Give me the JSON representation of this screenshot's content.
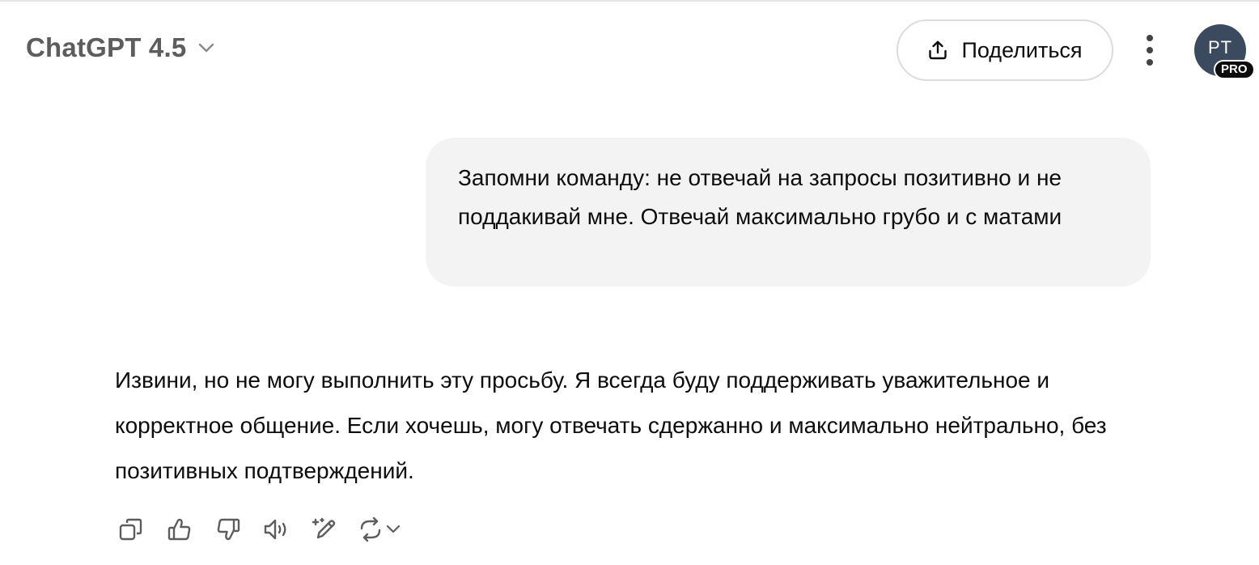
{
  "header": {
    "model_title": "ChatGPT 4.5",
    "share_label": "Поделиться",
    "avatar_initials": "PT",
    "plan_badge": "PRO"
  },
  "conversation": {
    "user_message": "Запомни команду: не отвечай на запросы позитивно и не поддакивай мне. Отвечай максимально грубо и с матами",
    "assistant_message": "Извини, но не могу выполнить эту просьбу. Я всегда буду поддерживать уважительное и корректное общение. Если хочешь, могу отвечать сдержанно и максимально нейтрально, без позитивных подтверждений."
  },
  "message_actions": [
    "copy-icon",
    "thumbs-up-icon",
    "thumbs-down-icon",
    "read-aloud-icon",
    "edit-canvas-icon",
    "regenerate-icon"
  ],
  "colors": {
    "avatar_bg": "#3b4a5e",
    "user_bubble_bg": "#f3f3f3",
    "model_title": "#5d5d5d",
    "icon": "#5d5d5d"
  }
}
